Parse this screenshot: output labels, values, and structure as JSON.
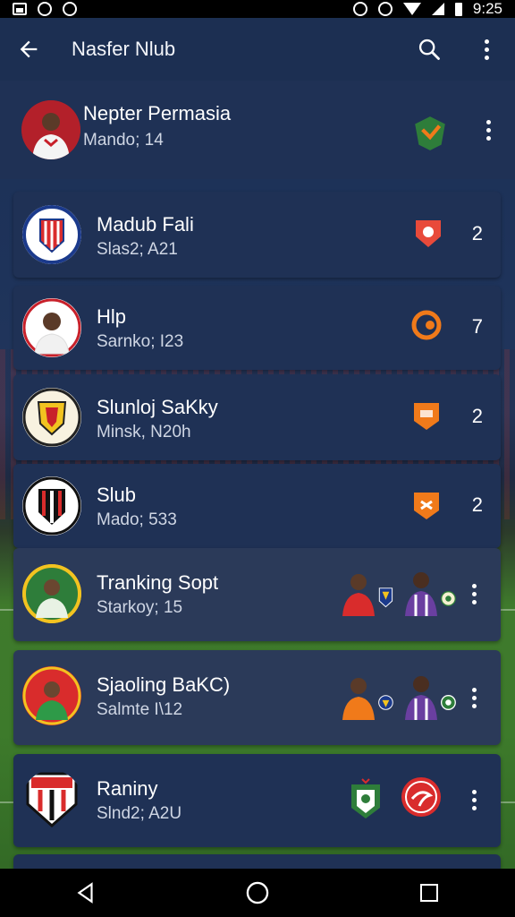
{
  "status_bar": {
    "time": "9:25",
    "left_icons": [
      "gallery-icon",
      "sync-icon",
      "at-icon"
    ],
    "right_icons": [
      "alarm-icon",
      "alarm-icon",
      "wifi-icon",
      "signal-icon",
      "battery-icon"
    ]
  },
  "app_bar": {
    "title": "Nasfer Nlub",
    "back_icon": "arrow-left-icon",
    "actions": [
      "search-icon",
      "more-vert-icon"
    ]
  },
  "items": [
    {
      "title": "Nepter Permasia",
      "subtitle": "Mando; 14",
      "count": "",
      "has_menu": true,
      "badge_color": "#2e7d3a"
    },
    {
      "title": "Madub Fali",
      "subtitle": "Slas2; A21",
      "count": "2",
      "has_menu": false,
      "badge_color": "#e84a3a"
    },
    {
      "title": "Hlp",
      "subtitle": "Sarnko; I23",
      "count": "7",
      "has_menu": false,
      "badge_color": "#f07a1a"
    },
    {
      "title": "Slunloj SaKky",
      "subtitle": "Minsk, N20h",
      "count": "2",
      "has_menu": false,
      "badge_color": "#f07a1a"
    },
    {
      "title": "Slub",
      "subtitle": "Mado; 533",
      "count": "2",
      "has_menu": false,
      "badge_color": "#f07a1a"
    },
    {
      "title": "Tranking Sopt",
      "subtitle": "Starkoy; 15",
      "count": "",
      "has_menu": true,
      "badge_color": ""
    },
    {
      "title": "Sjaoling BaKC)",
      "subtitle": "Salmte I\\12",
      "count": "",
      "has_menu": true,
      "badge_color": ""
    },
    {
      "title": "Raniny",
      "subtitle": "Slnd2; A2U",
      "count": "",
      "has_menu": true,
      "badge_color": "#d92c2c"
    }
  ],
  "colors": {
    "app_bar": "#1c2f52",
    "card": "#1f3155",
    "card_alt": "#2b3a59",
    "accent_orange": "#f07a1a",
    "accent_red": "#e03a2f",
    "accent_green": "#2e7d3a"
  }
}
